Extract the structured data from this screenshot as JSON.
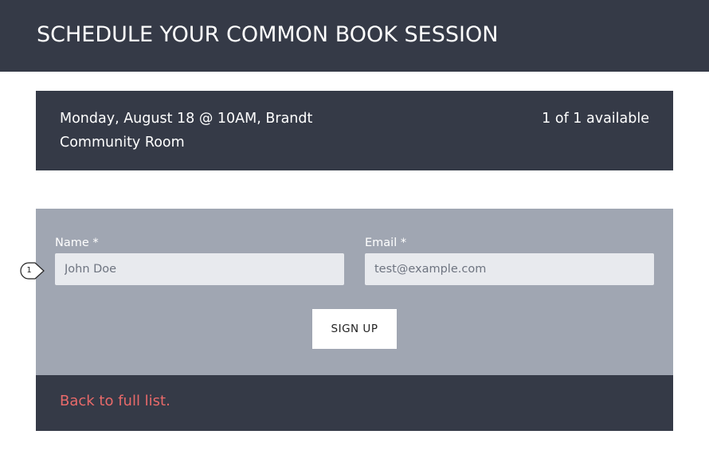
{
  "header": {
    "title": "SCHEDULE YOUR COMMON BOOK SESSION"
  },
  "session": {
    "description": "Monday, August 18 @ 10AM, Brandt Community Room",
    "availability": "1 of 1 available"
  },
  "form": {
    "name_label": "Name *",
    "name_placeholder": "John Doe",
    "name_value": "",
    "email_label": "Email *",
    "email_placeholder": "test@example.com",
    "email_value": "",
    "submit_label": "SIGN UP"
  },
  "footer": {
    "back_link_label": "Back to full list."
  },
  "annotation": {
    "marker_label": "1"
  },
  "colors": {
    "dark_panel": "#353a47",
    "form_panel": "#a0a6b2",
    "input_bg": "#e8eaee",
    "link": "#e96a6a"
  },
  "icons": {
    "marker": "numbered-callout-icon"
  }
}
